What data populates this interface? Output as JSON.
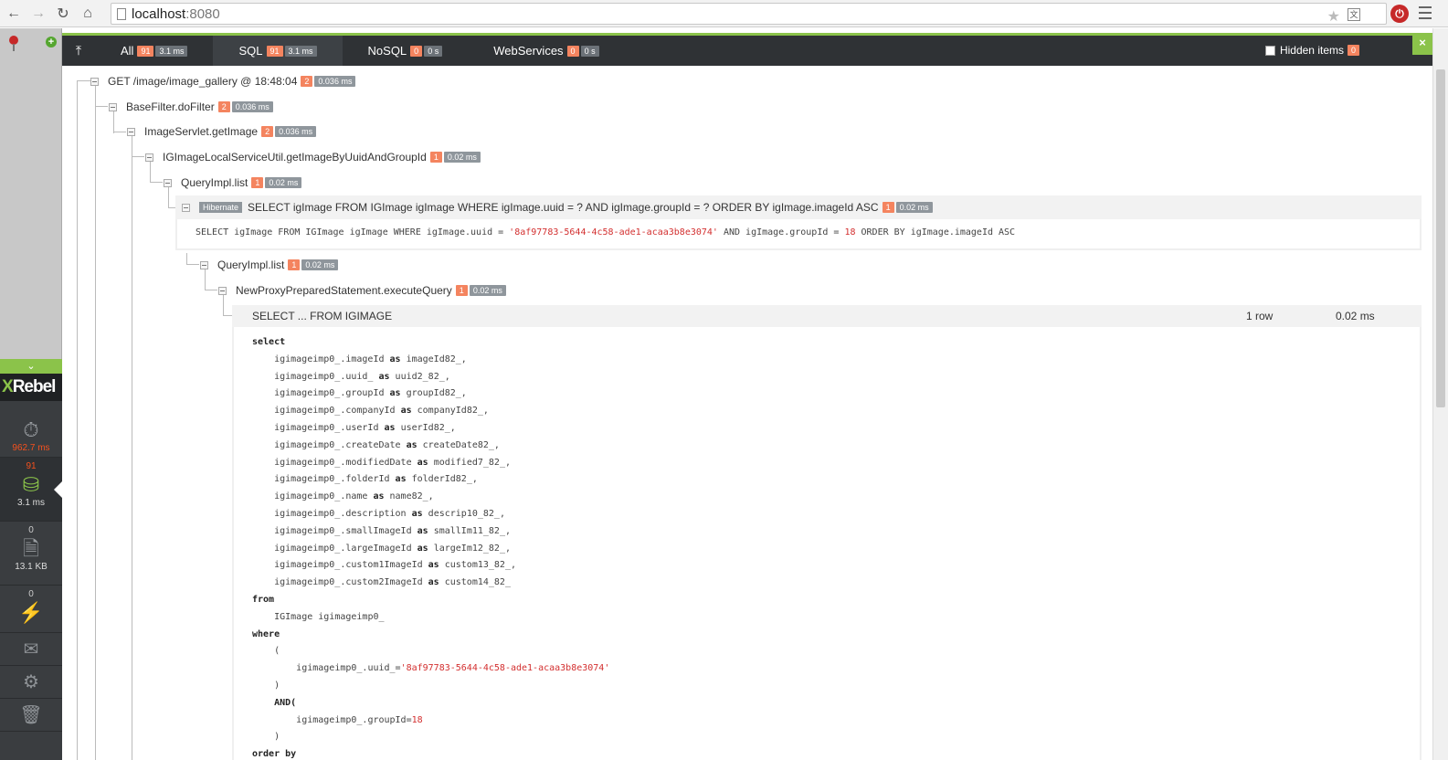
{
  "browser": {
    "url_host": "localhost",
    "url_port": ":8080"
  },
  "sidebar": {
    "logo_x": "X",
    "logo_rest": "Rebel",
    "time_value": "962.7 ms",
    "sql_count": "91",
    "sql_time": "3.1 ms",
    "io_count": "0",
    "io_size": "13.1 KB",
    "exceptions_count": "0"
  },
  "tabs": [
    {
      "label": "All",
      "count": "91",
      "time": "3.1 ms"
    },
    {
      "label": "SQL",
      "count": "91",
      "time": "3.1 ms"
    },
    {
      "label": "NoSQL",
      "count": "0",
      "time": "0 s"
    },
    {
      "label": "WebServices",
      "count": "0",
      "time": "0 s"
    }
  ],
  "hidden_items": {
    "label": "Hidden items",
    "count": "0"
  },
  "tree": [
    {
      "label": "GET /image/image_gallery @ 18:48:04",
      "count": "2",
      "time": "0.036 ms"
    },
    {
      "label": "BaseFilter.doFilter",
      "count": "2",
      "time": "0.036 ms"
    },
    {
      "label": "ImageServlet.getImage",
      "count": "2",
      "time": "0.036 ms"
    },
    {
      "label": "IGImageLocalServiceUtil.getImageByUuidAndGroupId",
      "count": "1",
      "time": "0.02 ms"
    },
    {
      "label": "QueryImpl.list",
      "count": "1",
      "time": "0.02 ms"
    },
    {
      "tag": "Hibernate",
      "label": "SELECT igImage FROM IGImage igImage WHERE igImage.uuid = ? AND igImage.groupId = ? ORDER BY igImage.imageId ASC",
      "count": "1",
      "time": "0.02 ms"
    },
    {
      "label": "QueryImpl.list",
      "count": "1",
      "time": "0.02 ms"
    },
    {
      "label": "NewProxyPreparedStatement.executeQuery",
      "count": "1",
      "time": "0.02 ms"
    }
  ],
  "hql_expanded": {
    "prefix": "SELECT igImage FROM IGImage igImage WHERE igImage.uuid = ",
    "uuid": "'8af97783-5644-4c58-ade1-acaa3b8e3074'",
    "middle": " AND igImage.groupId = ",
    "group": "18",
    "suffix": " ORDER BY igImage.imageId ASC"
  },
  "sql_result": {
    "label": "SELECT ... FROM IGIMAGE",
    "rows": "1 row",
    "time": "0.02 ms"
  },
  "sql_code": {
    "select_kw": "select",
    "columns": [
      {
        "col": "igimageimp0_.imageId",
        "alias": "imageId82_,"
      },
      {
        "col": "igimageimp0_.uuid_",
        "alias": "uuid2_82_,"
      },
      {
        "col": "igimageimp0_.groupId",
        "alias": "groupId82_,"
      },
      {
        "col": "igimageimp0_.companyId",
        "alias": "companyId82_,"
      },
      {
        "col": "igimageimp0_.userId",
        "alias": "userId82_,"
      },
      {
        "col": "igimageimp0_.createDate",
        "alias": "createDate82_,"
      },
      {
        "col": "igimageimp0_.modifiedDate",
        "alias": "modified7_82_,"
      },
      {
        "col": "igimageimp0_.folderId",
        "alias": "folderId82_,"
      },
      {
        "col": "igimageimp0_.name",
        "alias": "name82_,"
      },
      {
        "col": "igimageimp0_.description",
        "alias": "descrip10_82_,"
      },
      {
        "col": "igimageimp0_.smallImageId",
        "alias": "smallIm11_82_,"
      },
      {
        "col": "igimageimp0_.largeImageId",
        "alias": "largeIm12_82_,"
      },
      {
        "col": "igimageimp0_.custom1ImageId",
        "alias": "custom13_82_,"
      },
      {
        "col": "igimageimp0_.custom2ImageId",
        "alias": "custom14_82_"
      }
    ],
    "as_kw": "as",
    "from_kw": "from",
    "from_table": "IGImage igimageimp0_",
    "where_kw": "where",
    "open_paren": "(",
    "uuid_cond": "igimageimp0_.uuid_=",
    "uuid_val": "'8af97783-5644-4c58-ade1-acaa3b8e3074'",
    "close_paren": ")",
    "and_kw": "AND(",
    "group_cond": "igimageimp0_.groupId=",
    "group_val": "18",
    "close_paren2": ")",
    "order_kw": "order by"
  },
  "colors": {
    "accent": "#8bc34a",
    "badge_orange": "#f4845f",
    "badge_gray": "#8f969c",
    "dark": "#2f3235",
    "string_red": "#d32f2f"
  }
}
